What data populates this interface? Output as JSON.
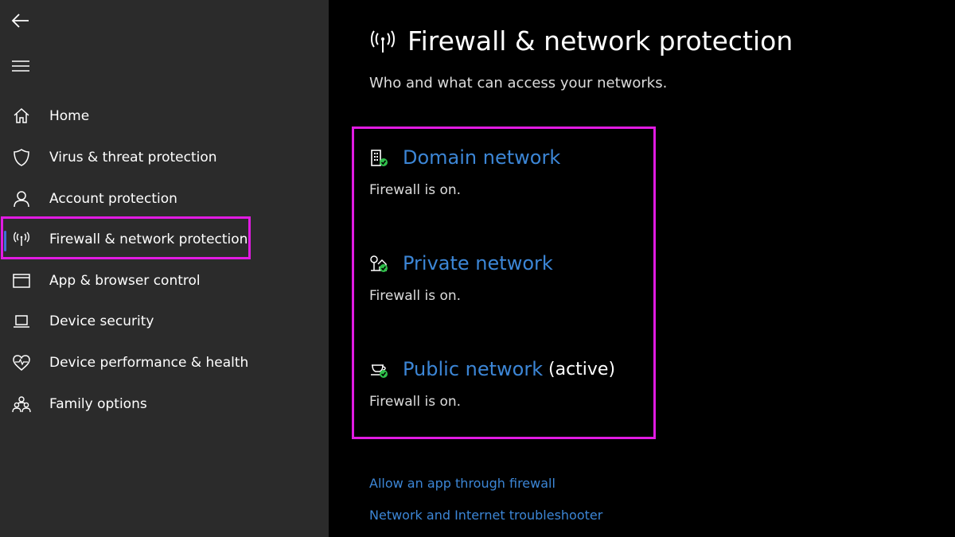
{
  "sidebar": {
    "items": [
      {
        "label": "Home",
        "icon": "home-icon"
      },
      {
        "label": "Virus & threat protection",
        "icon": "shield-icon"
      },
      {
        "label": "Account protection",
        "icon": "person-icon"
      },
      {
        "label": "Firewall & network protection",
        "icon": "antenna-icon",
        "selected": true
      },
      {
        "label": "App & browser control",
        "icon": "browser-window-icon"
      },
      {
        "label": "Device security",
        "icon": "laptop-icon"
      },
      {
        "label": "Device performance & health",
        "icon": "heart-pulse-icon"
      },
      {
        "label": "Family options",
        "icon": "family-icon"
      }
    ]
  },
  "main": {
    "title": "Firewall & network protection",
    "subtitle": "Who and what can access your networks.",
    "networks": [
      {
        "name": "Domain network",
        "status": "Firewall is on.",
        "icon": "domain-network-icon"
      },
      {
        "name": "Private network",
        "status": "Firewall is on.",
        "icon": "private-network-icon"
      },
      {
        "name": "Public network",
        "status": "Firewall is on.",
        "active_label": "(active)",
        "icon": "public-network-icon"
      }
    ],
    "links": {
      "allow_app": "Allow an app through firewall",
      "troubleshooter": "Network and Internet troubleshooter"
    }
  },
  "colors": {
    "sidebar_bg": "#2b2b2b",
    "main_bg": "#000000",
    "link": "#3c86d6",
    "highlight": "#e11be2",
    "selection_indicator": "#3f6fd8",
    "status_ok": "#2fbf4a"
  }
}
